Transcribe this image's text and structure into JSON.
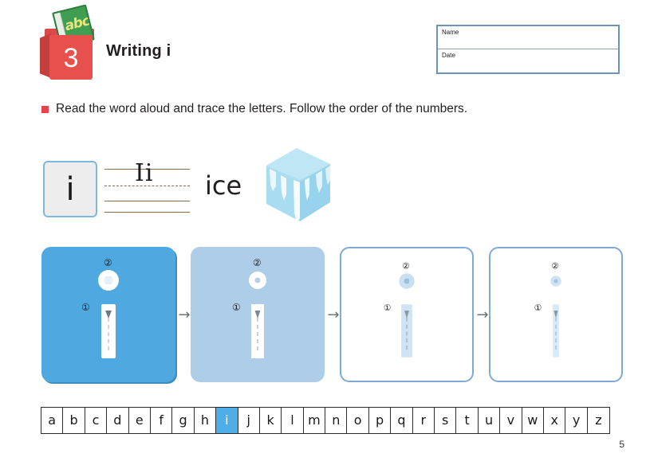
{
  "header": {
    "lesson_number": "3",
    "book_text": "abc",
    "title": "Writing i"
  },
  "name_date": {
    "name_label": "Name",
    "date_label": "Date"
  },
  "instruction": {
    "text": "Read the word aloud and trace the letters. Follow the order of the numbers."
  },
  "letter_demo": {
    "card_letter": "i",
    "ruled_letters": "Ii",
    "word": "ice",
    "illustration_name": "ice-cube"
  },
  "practice": {
    "stroke_markers": [
      "①",
      "②"
    ],
    "arrow_glyph": "→",
    "panels": [
      {
        "name": "panel-solid-blue",
        "fade": "0"
      },
      {
        "name": "panel-light-blue",
        "fade": "1"
      },
      {
        "name": "panel-white-guide",
        "fade": "2"
      },
      {
        "name": "panel-white-faint",
        "fade": "3"
      }
    ]
  },
  "alphabet": {
    "letters": [
      "a",
      "b",
      "c",
      "d",
      "e",
      "f",
      "g",
      "h",
      "i",
      "j",
      "k",
      "l",
      "m",
      "n",
      "o",
      "p",
      "q",
      "r",
      "s",
      "t",
      "u",
      "v",
      "w",
      "x",
      "y",
      "z"
    ],
    "active_letter": "i"
  },
  "footer": {
    "page_number": "5"
  },
  "colors": {
    "accent_blue": "#4fade8",
    "panel_blue": "#4fa9e0",
    "panel_light_blue": "#aecde8",
    "bullet_red": "#e8434a",
    "badge_red": "#e8504e",
    "rule_brown": "#8a6a4a"
  }
}
